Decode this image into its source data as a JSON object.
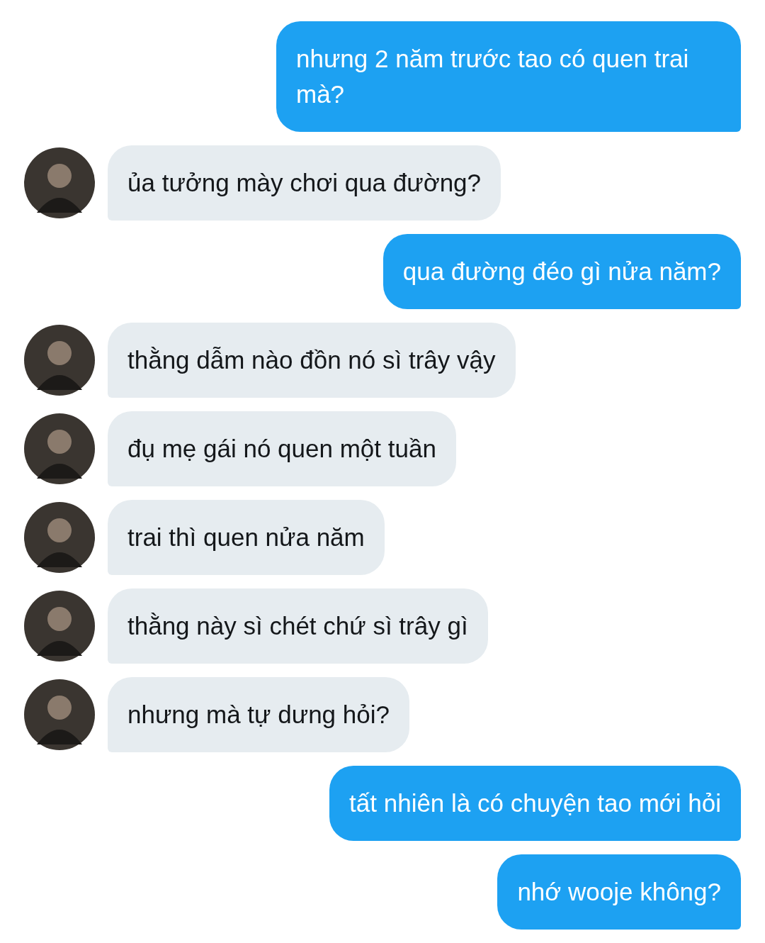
{
  "messages": [
    {
      "kind": "sent",
      "text": "nhưng 2 năm trước tao có quen trai mà?"
    },
    {
      "kind": "received",
      "text": "ủa tưởng mày chơi qua đường?"
    },
    {
      "kind": "sent",
      "text": "qua đường đéo gì nửa năm?"
    },
    {
      "kind": "received",
      "text": "thằng dẫm nào đồn nó sì trây vậy"
    },
    {
      "kind": "received",
      "text": "đụ mẹ gái nó quen một tuần"
    },
    {
      "kind": "received",
      "text": "trai thì quen nửa năm"
    },
    {
      "kind": "received",
      "text": "thằng này sì chét chứ sì trây gì"
    },
    {
      "kind": "received",
      "text": "nhưng mà tự dưng hỏi?"
    },
    {
      "kind": "sent",
      "text": "tất nhiên là có chuyện tao mới hỏi"
    },
    {
      "kind": "sent",
      "text": "nhớ wooje không?"
    }
  ]
}
